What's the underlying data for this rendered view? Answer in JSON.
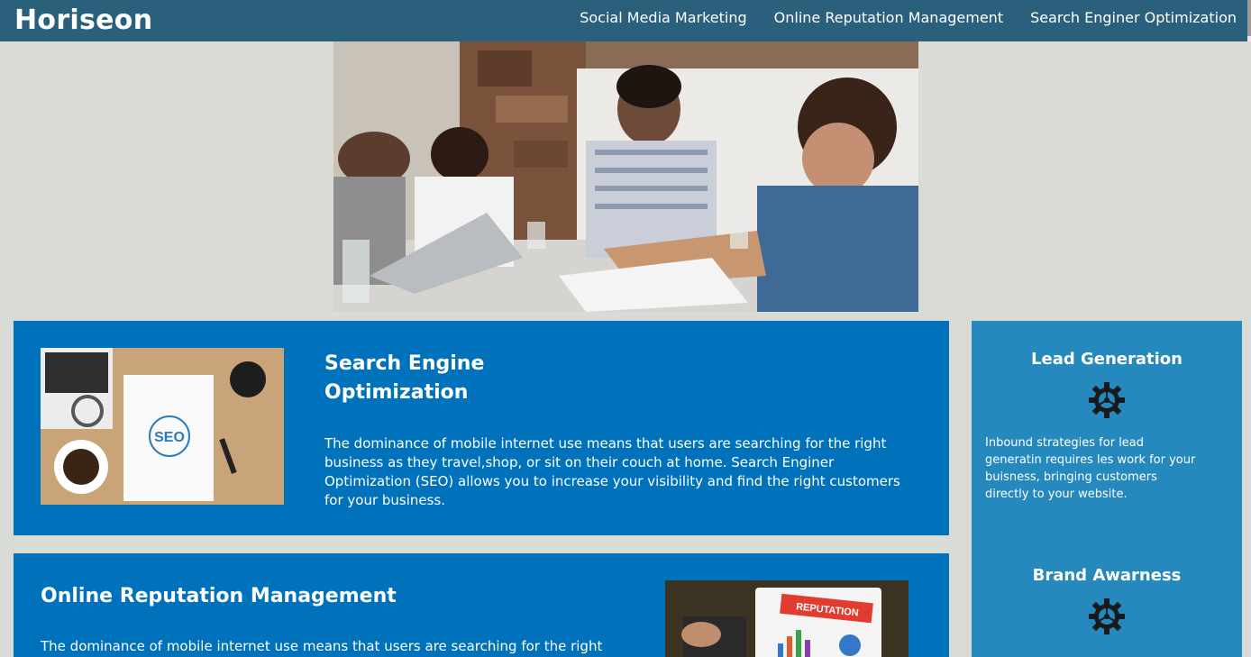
{
  "header": {
    "logo": "Horiseon",
    "nav": [
      {
        "label": "Social Media Marketing"
      },
      {
        "label": "Online Reputation Management"
      },
      {
        "label": "Search Enginer Optimization"
      }
    ]
  },
  "content": [
    {
      "title": "Search Engine Optimization",
      "text": "The dominance of mobile internet use means that users are searching for the right business as they travel,shop, or sit on their couch at home. Search Enginer Optimization (SEO) allows you to increase your visibility and find the right customers for your business.",
      "image_text": "SEO"
    },
    {
      "title": "Online Reputation Management",
      "text": "The dominance of mobile internet use means that users are searching for the right business",
      "image_text": "REPUTATION"
    }
  ],
  "benefits": [
    {
      "title": "Lead Generation",
      "icon": "gear-icon",
      "text": "Inbound strategies for lead generatin requires les work for your buisness, bringing customers directly to your website."
    },
    {
      "title": "Brand Awarness",
      "icon": "gear-icon"
    }
  ],
  "colors": {
    "header_bg": "#2a607c",
    "page_bg": "#d9dbd7",
    "card_bg": "#0072bb",
    "sidebar_bg": "#2589bd"
  }
}
